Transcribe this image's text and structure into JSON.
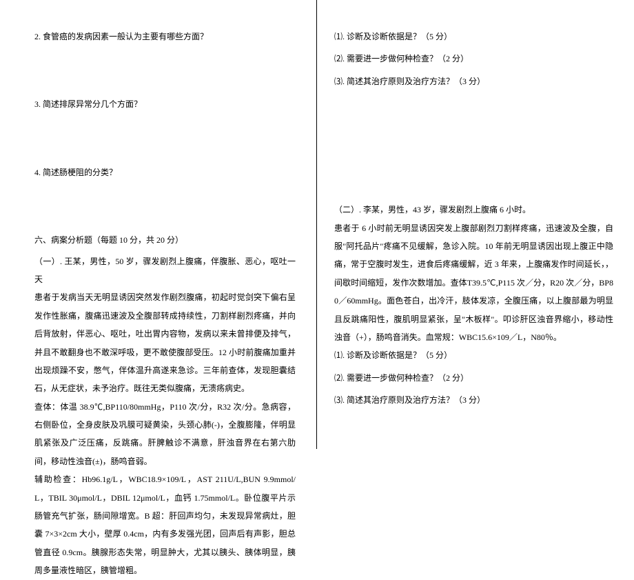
{
  "left": {
    "q2": "2. 食管癌的发病因素一般认为主要有哪些方面？",
    "q3": "3. 简述排尿异常分几个方面？",
    "q4": "4. 简述肠梗阻的分类？",
    "section6_header": "六、病案分析题（每题 10 分，共 20 分）",
    "case1_intro": "（一）. 王某，男性，50 岁，骤发剧烈上腹痛，伴腹胀、恶心，呕吐一天",
    "case1_p1": "患者于发病当天无明显诱因突然发作剧烈腹痛，初起时觉剑突下偏右呈发作性胀痛，腹痛迅速波及全腹部转成持续性，刀割样剧烈疼痛，并向后背放射，伴恶心、呕吐，吐出胃内容物，发病以来未曾排便及排气，并且不敢翻身也不敢深呼吸，更不敢使腹部受压。12 小时前腹痛加重并出现烦躁不安，憋气，伴体温升高遂来急诊。三年前查体，发现胆囊结石，从无症状，未予治疗。既往无类似腹痛，无溃疡病史。",
    "case1_p2": "查体：体温 38.9℃,BP110/80mmHg，P110 次/分，R32 次/分。急病容，右侧卧位，全身皮肤及巩膜可疑黄染，头颈心肺(-)，全腹膨隆，伴明显肌紧张及广泛压痛，反跳痛。肝脾触诊不满意，肝浊音界在右第六肋间，移动性浊音(±)，肠鸣音弱。",
    "case1_p3": "辅助检查：Hb96.1g/L，WBC18.9×109/L，AST 211U/L,BUN 9.9mmol/L，TBIL 30μmol/L，DBIL 12μmol/L，血钙 1.75mmol/L。卧位腹平片示肠管充气扩张，肠间隙增宽。B 超：肝回声均匀，未发现异常病灶，胆囊 7×3×2cm 大小，壁厚 0.4cm，内有多发强光团，回声后有声影，胆总管直径 0.9cm。胰腺形态失常，明显肿大，尤其以胰头、胰体明显，胰周多量液性暗区，胰管增粗。"
  },
  "right": {
    "sub1": "⑴. 诊断及诊断依据是？（5 分）",
    "sub2": "⑵. 需要进一步做何种检查？（2 分）",
    "sub3": "⑶. 简述其治疗原则及治疗方法？（3 分）",
    "case2_intro": "（二）. 李某，男性，43 岁，骤发剧烈上腹痛 6 小时。",
    "case2_p1": "患者于 6 小时前无明显诱因突发上腹部剧烈刀割样疼痛，迅速波及全腹，自服\"阿托品片\"疼痛不见缓解，急诊入院。10 年前无明显诱因出现上腹正中隐痛，常于空腹时发生，进食后疼痛缓解，近 3 年来，上腹痛发作时间延长，，间歇时间缩短，发作次数增加。查体T39.5℃,P115 次／分，R20 次／分，BP80／60mmHg。面色苍白，出冷汗，肢体发凉，全腹压痛，以上腹部最为明显且反跳痛阳性，腹肌明显紧张，呈\"木板样\"。叩诊肝区浊音界缩小，移动性浊音（+），肠鸣音消失。血常规：WBC15.6×109／L，N80％。",
    "case2_sub1": "⑴. 诊断及诊断依据是？（5 分）",
    "case2_sub2": "⑵. 需要进一步做何种检查？（2 分）",
    "case2_sub3": "⑶. 简述其治疗原则及治疗方法？（3 分）"
  }
}
